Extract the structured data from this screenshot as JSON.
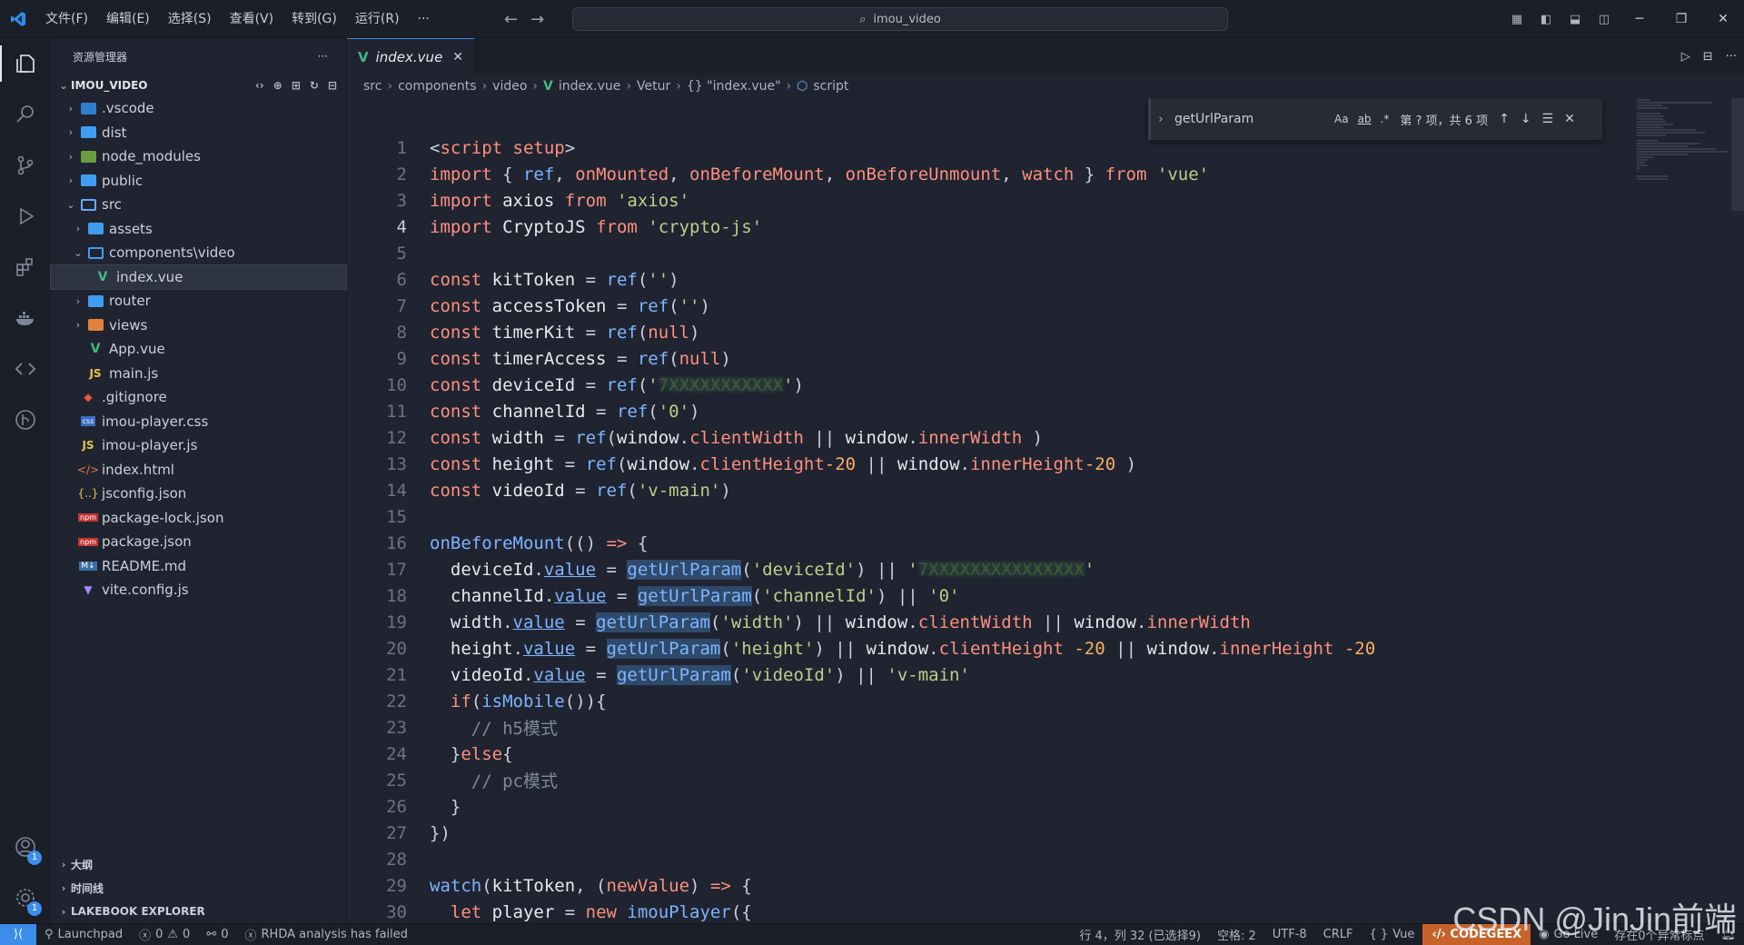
{
  "titlebar": {
    "menu": [
      "文件(F)",
      "编辑(E)",
      "选择(S)",
      "查看(V)",
      "转到(G)",
      "运行(R)",
      "···"
    ],
    "search": "imou_video"
  },
  "sidebar": {
    "title": "资源管理器",
    "root": "IMOU_VIDEO",
    "tree": [
      {
        "label": ".vscode",
        "indent": 1,
        "kind": "folder-vscode",
        "chev": "›"
      },
      {
        "label": "dist",
        "indent": 1,
        "kind": "folder",
        "chev": "›"
      },
      {
        "label": "node_modules",
        "indent": 1,
        "kind": "folder-node",
        "chev": "›"
      },
      {
        "label": "public",
        "indent": 1,
        "kind": "folder",
        "chev": "›"
      },
      {
        "label": "src",
        "indent": 1,
        "kind": "folder-src",
        "chev": "⌄"
      },
      {
        "label": "assets",
        "indent": 2,
        "kind": "folder",
        "chev": "›"
      },
      {
        "label": "components\\video",
        "indent": 2,
        "kind": "folder-open",
        "chev": "⌄"
      },
      {
        "label": "index.vue",
        "indent": 3,
        "kind": "vue",
        "chev": "",
        "selected": true
      },
      {
        "label": "router",
        "indent": 2,
        "kind": "folder",
        "chev": "›"
      },
      {
        "label": "views",
        "indent": 2,
        "kind": "folder-views",
        "chev": "›"
      },
      {
        "label": "App.vue",
        "indent": 2,
        "kind": "vue",
        "chev": ""
      },
      {
        "label": "main.js",
        "indent": 2,
        "kind": "js",
        "chev": ""
      },
      {
        "label": ".gitignore",
        "indent": 1,
        "kind": "git",
        "chev": ""
      },
      {
        "label": "imou-player.css",
        "indent": 1,
        "kind": "css",
        "chev": ""
      },
      {
        "label": "imou-player.js",
        "indent": 1,
        "kind": "js",
        "chev": ""
      },
      {
        "label": "index.html",
        "indent": 1,
        "kind": "html",
        "chev": ""
      },
      {
        "label": "jsconfig.json",
        "indent": 1,
        "kind": "json",
        "chev": ""
      },
      {
        "label": "package-lock.json",
        "indent": 1,
        "kind": "npm",
        "chev": ""
      },
      {
        "label": "package.json",
        "indent": 1,
        "kind": "npm",
        "chev": ""
      },
      {
        "label": "README.md",
        "indent": 1,
        "kind": "md",
        "chev": ""
      },
      {
        "label": "vite.config.js",
        "indent": 1,
        "kind": "vite",
        "chev": ""
      }
    ],
    "sections": [
      "大纲",
      "时间线",
      "LAKEBOOK EXPLORER"
    ]
  },
  "editor": {
    "tab": "index.vue",
    "breadcrumb": [
      "src",
      "components",
      "video",
      "index.vue",
      "Vetur",
      "{} \"index.vue\"",
      "script"
    ],
    "find": {
      "query": "getUrlParam",
      "count": "第 ? 项，共 6 项",
      "opt_case": "Aa",
      "opt_word": "ab",
      "opt_regex": ".*"
    },
    "current_line": 4,
    "lines": [
      [
        [
          "pun",
          "<"
        ],
        [
          "kw",
          "script"
        ],
        [
          "pun",
          " "
        ],
        [
          "kw",
          "setup"
        ],
        [
          "pun",
          ">"
        ]
      ],
      [
        [
          "kw",
          "import"
        ],
        [
          "pun",
          " { "
        ],
        [
          "fn",
          "ref"
        ],
        [
          "pun",
          ", "
        ],
        [
          "kw",
          "onMounted"
        ],
        [
          "pun",
          ", "
        ],
        [
          "kw",
          "onBeforeMount"
        ],
        [
          "pun",
          ", "
        ],
        [
          "kw",
          "onBeforeUnmount"
        ],
        [
          "pun",
          ", "
        ],
        [
          "kw",
          "watch"
        ],
        [
          "pun",
          " } "
        ],
        [
          "kw",
          "from"
        ],
        [
          "pun",
          " "
        ],
        [
          "str",
          "'vue'"
        ]
      ],
      [
        [
          "kw",
          "import"
        ],
        [
          "pun",
          " "
        ],
        [
          "var",
          "axios"
        ],
        [
          "pun",
          " "
        ],
        [
          "kw",
          "from"
        ],
        [
          "pun",
          " "
        ],
        [
          "str",
          "'axios'"
        ]
      ],
      [
        [
          "kw",
          "import"
        ],
        [
          "pun",
          " "
        ],
        [
          "var",
          "CryptoJS"
        ],
        [
          "pun",
          " "
        ],
        [
          "kw",
          "from"
        ],
        [
          "pun",
          " "
        ],
        [
          "str",
          "'crypto-js'"
        ]
      ],
      [],
      [
        [
          "kw",
          "const"
        ],
        [
          "pun",
          " "
        ],
        [
          "var",
          "kitToken"
        ],
        [
          "pun",
          " = "
        ],
        [
          "fn",
          "ref"
        ],
        [
          "pun",
          "("
        ],
        [
          "str",
          "''"
        ],
        [
          "pun",
          ")"
        ]
      ],
      [
        [
          "kw",
          "const"
        ],
        [
          "pun",
          " "
        ],
        [
          "var",
          "accessToken"
        ],
        [
          "pun",
          " = "
        ],
        [
          "fn",
          "ref"
        ],
        [
          "pun",
          "("
        ],
        [
          "str",
          "''"
        ],
        [
          "pun",
          ")"
        ]
      ],
      [
        [
          "kw",
          "const"
        ],
        [
          "pun",
          " "
        ],
        [
          "var",
          "timerKit"
        ],
        [
          "pun",
          " = "
        ],
        [
          "fn",
          "ref"
        ],
        [
          "pun",
          "("
        ],
        [
          "kw",
          "null"
        ],
        [
          "pun",
          ")"
        ]
      ],
      [
        [
          "kw",
          "const"
        ],
        [
          "pun",
          " "
        ],
        [
          "var",
          "timerAccess"
        ],
        [
          "pun",
          " = "
        ],
        [
          "fn",
          "ref"
        ],
        [
          "pun",
          "("
        ],
        [
          "kw",
          "null"
        ],
        [
          "pun",
          ")"
        ]
      ],
      [
        [
          "kw",
          "const"
        ],
        [
          "pun",
          " "
        ],
        [
          "var",
          "deviceId"
        ],
        [
          "pun",
          " = "
        ],
        [
          "fn",
          "ref"
        ],
        [
          "pun",
          "("
        ],
        [
          "str",
          "'"
        ],
        [
          "blur",
          "7XXXXXXXXXXX"
        ],
        [
          "str",
          "'"
        ],
        [
          "pun",
          ")"
        ]
      ],
      [
        [
          "kw",
          "const"
        ],
        [
          "pun",
          " "
        ],
        [
          "var",
          "channelId"
        ],
        [
          "pun",
          " = "
        ],
        [
          "fn",
          "ref"
        ],
        [
          "pun",
          "("
        ],
        [
          "str",
          "'0'"
        ],
        [
          "pun",
          ")"
        ]
      ],
      [
        [
          "kw",
          "const"
        ],
        [
          "pun",
          " "
        ],
        [
          "var",
          "width"
        ],
        [
          "pun",
          " = "
        ],
        [
          "fn",
          "ref"
        ],
        [
          "pun",
          "("
        ],
        [
          "var",
          "window"
        ],
        [
          "pun",
          "."
        ],
        [
          "prop",
          "clientWidth"
        ],
        [
          "pun",
          " || "
        ],
        [
          "var",
          "window"
        ],
        [
          "pun",
          "."
        ],
        [
          "prop",
          "innerWidth"
        ],
        [
          "pun",
          " )"
        ]
      ],
      [
        [
          "kw",
          "const"
        ],
        [
          "pun",
          " "
        ],
        [
          "var",
          "height"
        ],
        [
          "pun",
          " = "
        ],
        [
          "fn",
          "ref"
        ],
        [
          "pun",
          "("
        ],
        [
          "var",
          "window"
        ],
        [
          "pun",
          "."
        ],
        [
          "prop",
          "clientHeight"
        ],
        [
          "num",
          "-20"
        ],
        [
          "pun",
          " || "
        ],
        [
          "var",
          "window"
        ],
        [
          "pun",
          "."
        ],
        [
          "prop",
          "innerHeight"
        ],
        [
          "num",
          "-20"
        ],
        [
          "pun",
          " )"
        ]
      ],
      [
        [
          "kw",
          "const"
        ],
        [
          "pun",
          " "
        ],
        [
          "var",
          "videoId"
        ],
        [
          "pun",
          " = "
        ],
        [
          "fn",
          "ref"
        ],
        [
          "pun",
          "("
        ],
        [
          "str",
          "'v-main'"
        ],
        [
          "pun",
          ")"
        ]
      ],
      [],
      [
        [
          "fn",
          "onBeforeMount"
        ],
        [
          "pun",
          "(() "
        ],
        [
          "kw",
          "=>"
        ],
        [
          "pun",
          " {"
        ]
      ],
      [
        [
          "pun",
          "  "
        ],
        [
          "var",
          "deviceId"
        ],
        [
          "pun",
          "."
        ],
        [
          "ul",
          "value"
        ],
        [
          "pun",
          " = "
        ],
        [
          "hl",
          "getUrlParam"
        ],
        [
          "pun",
          "("
        ],
        [
          "str",
          "'deviceId'"
        ],
        [
          "pun",
          ") || "
        ],
        [
          "str",
          "'"
        ],
        [
          "blur",
          "7XXXXXXXXXXXXXXX"
        ],
        [
          "str",
          "'"
        ]
      ],
      [
        [
          "pun",
          "  "
        ],
        [
          "var",
          "channelId"
        ],
        [
          "pun",
          "."
        ],
        [
          "ul",
          "value"
        ],
        [
          "pun",
          " = "
        ],
        [
          "hl",
          "getUrlParam"
        ],
        [
          "pun",
          "("
        ],
        [
          "str",
          "'channelId'"
        ],
        [
          "pun",
          ") || "
        ],
        [
          "str",
          "'0'"
        ]
      ],
      [
        [
          "pun",
          "  "
        ],
        [
          "var",
          "width"
        ],
        [
          "pun",
          "."
        ],
        [
          "ul",
          "value"
        ],
        [
          "pun",
          " = "
        ],
        [
          "hl",
          "getUrlParam"
        ],
        [
          "pun",
          "("
        ],
        [
          "str",
          "'width'"
        ],
        [
          "pun",
          ") || "
        ],
        [
          "var",
          "window"
        ],
        [
          "pun",
          "."
        ],
        [
          "prop",
          "clientWidth"
        ],
        [
          "pun",
          " || "
        ],
        [
          "var",
          "window"
        ],
        [
          "pun",
          "."
        ],
        [
          "prop",
          "innerWidth"
        ]
      ],
      [
        [
          "pun",
          "  "
        ],
        [
          "var",
          "height"
        ],
        [
          "pun",
          "."
        ],
        [
          "ul",
          "value"
        ],
        [
          "pun",
          " = "
        ],
        [
          "hl",
          "getUrlParam"
        ],
        [
          "pun",
          "("
        ],
        [
          "str",
          "'height'"
        ],
        [
          "pun",
          ") || "
        ],
        [
          "var",
          "window"
        ],
        [
          "pun",
          "."
        ],
        [
          "prop",
          "clientHeight"
        ],
        [
          "pun",
          " "
        ],
        [
          "num",
          "-20"
        ],
        [
          "pun",
          " || "
        ],
        [
          "var",
          "window"
        ],
        [
          "pun",
          "."
        ],
        [
          "prop",
          "innerHeight"
        ],
        [
          "pun",
          " "
        ],
        [
          "num",
          "-20"
        ]
      ],
      [
        [
          "pun",
          "  "
        ],
        [
          "var",
          "videoId"
        ],
        [
          "pun",
          "."
        ],
        [
          "ul",
          "value"
        ],
        [
          "pun",
          " = "
        ],
        [
          "hl",
          "getUrlParam"
        ],
        [
          "pun",
          "("
        ],
        [
          "str",
          "'videoId'"
        ],
        [
          "pun",
          ") || "
        ],
        [
          "str",
          "'v-main'"
        ]
      ],
      [
        [
          "pun",
          "  "
        ],
        [
          "kw",
          "if"
        ],
        [
          "pun",
          "("
        ],
        [
          "fn",
          "isMobile"
        ],
        [
          "pun",
          "()){"
        ]
      ],
      [
        [
          "pun",
          "    "
        ],
        [
          "cm",
          "// h5模式"
        ]
      ],
      [
        [
          "pun",
          "  }"
        ],
        [
          "kw",
          "else"
        ],
        [
          "pun",
          "{"
        ]
      ],
      [
        [
          "pun",
          "    "
        ],
        [
          "cm",
          "// pc模式"
        ]
      ],
      [
        [
          "pun",
          "  }"
        ]
      ],
      [
        [
          "pun",
          "})"
        ]
      ],
      [],
      [
        [
          "fn",
          "watch"
        ],
        [
          "pun",
          "("
        ],
        [
          "var",
          "kitToken"
        ],
        [
          "pun",
          ", ("
        ],
        [
          "prop",
          "newValue"
        ],
        [
          "pun",
          ") "
        ],
        [
          "kw",
          "=>"
        ],
        [
          "pun",
          " {"
        ]
      ],
      [
        [
          "pun",
          "  "
        ],
        [
          "kw",
          "let"
        ],
        [
          "pun",
          " "
        ],
        [
          "var",
          "player"
        ],
        [
          "pun",
          " = "
        ],
        [
          "kw",
          "new"
        ],
        [
          "pun",
          " "
        ],
        [
          "fn",
          "imouPlayer"
        ],
        [
          "pun",
          "({"
        ]
      ]
    ]
  },
  "statusbar": {
    "launchpad": "Launchpad",
    "errors": "0",
    "warnings": "0",
    "ports": "0",
    "rhda": "RHDA analysis has failed",
    "position": "行 4，列 32 (已选择9)",
    "spaces": "空格: 2",
    "encoding": "UTF-8",
    "eol": "CRLF",
    "language": "Vue",
    "codegeex": "CODEGEEX",
    "golive": "Go Live",
    "problems": "存在0个异常标点"
  },
  "watermark": "CSDN @JinJin前端",
  "colors": {
    "accent": "#3b8eea",
    "codegeex": "#c7622a",
    "bg": "#1f2430"
  }
}
